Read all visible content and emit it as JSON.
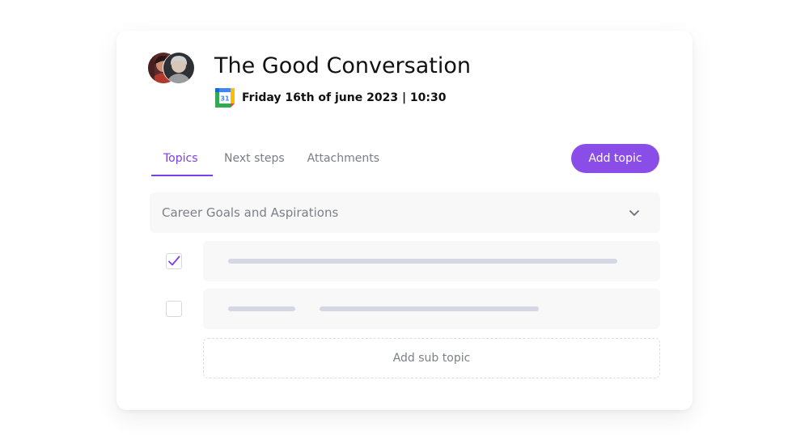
{
  "meeting": {
    "title": "The Good Conversation",
    "date": "Friday 16th of june 2023 | 10:30",
    "calendar_day": "31"
  },
  "tabs": [
    {
      "label": "Topics",
      "active": true
    },
    {
      "label": "Next steps",
      "active": false
    },
    {
      "label": "Attachments",
      "active": false
    }
  ],
  "actions": {
    "add_topic": "Add topic",
    "add_sub_topic": "Add sub topic"
  },
  "topic": {
    "label": "Career Goals and Aspirations",
    "expanded": true,
    "subtopics": [
      {
        "checked": true
      },
      {
        "checked": false
      }
    ]
  },
  "icons": {
    "calendar": "google-calendar-icon",
    "chevron": "chevron-down-icon",
    "check": "check-icon"
  },
  "colors": {
    "accent": "#8b4de7",
    "active_tab": "#7b3fe4",
    "text_dark": "#111111",
    "text_muted": "#7d7f88",
    "row_bg": "#f8f8f9",
    "placeholder_bar": "#d5d8e3"
  }
}
